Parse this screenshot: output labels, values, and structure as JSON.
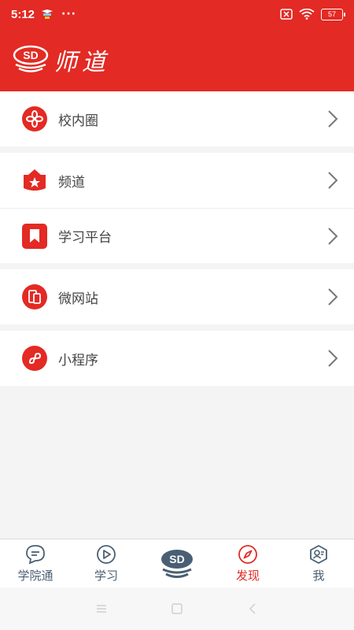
{
  "status_bar": {
    "time": "5:12",
    "dots": "···",
    "battery": "57"
  },
  "header": {
    "logo_text": "SD",
    "title": "师道"
  },
  "menu": {
    "groups": [
      {
        "items": [
          {
            "label": "校内圈",
            "icon": "flower-icon"
          }
        ]
      },
      {
        "items": [
          {
            "label": "频道",
            "icon": "star-shield-icon"
          },
          {
            "label": "学习平台",
            "icon": "bookmark-icon"
          }
        ]
      },
      {
        "items": [
          {
            "label": "微网站",
            "icon": "devices-icon"
          }
        ]
      },
      {
        "items": [
          {
            "label": "小程序",
            "icon": "mini-program-icon"
          }
        ]
      }
    ]
  },
  "tabbar": {
    "tabs": [
      {
        "label": "学院通",
        "icon": "chat-bubble-icon"
      },
      {
        "label": "学习",
        "icon": "play-circle-icon"
      },
      {
        "label": "",
        "icon": "sd-logo-icon"
      },
      {
        "label": "发现",
        "icon": "compass-icon",
        "active": true
      },
      {
        "label": "我",
        "icon": "user-card-icon"
      }
    ]
  },
  "colors": {
    "brand_red": "#e32a24",
    "tab_text": "#4a5f73",
    "label_text": "#444444"
  }
}
